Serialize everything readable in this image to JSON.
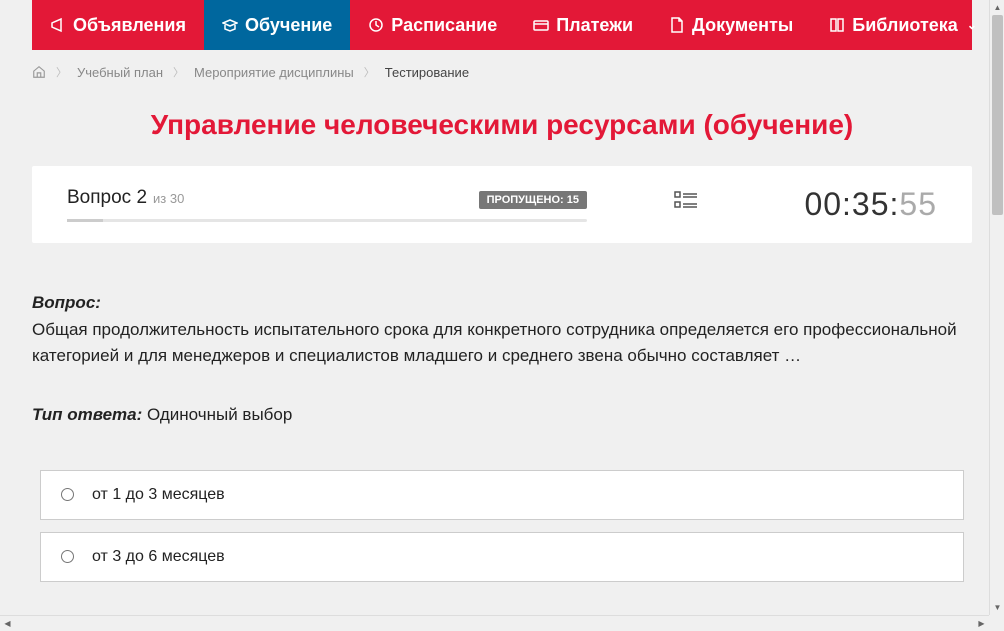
{
  "nav": {
    "items": [
      {
        "label": "Объявления",
        "icon": "megaphone"
      },
      {
        "label": "Обучение",
        "icon": "graduation",
        "active": true
      },
      {
        "label": "Расписание",
        "icon": "clock"
      },
      {
        "label": "Платежи",
        "icon": "card"
      },
      {
        "label": "Документы",
        "icon": "document"
      },
      {
        "label": "Библиотека",
        "icon": "book",
        "dropdown": true
      }
    ]
  },
  "breadcrumb": {
    "items": [
      {
        "label": "Учебный план"
      },
      {
        "label": "Мероприятие дисциплины"
      },
      {
        "label": "Тестирование",
        "current": true
      }
    ]
  },
  "page_title": "Управление человеческими ресурсами (обучение)",
  "progress": {
    "question_label": "Вопрос 2",
    "total_label": "из 30",
    "skipped_label": "ПРОПУЩЕНО: 15"
  },
  "timer": {
    "main": "00:35:",
    "seconds": "55"
  },
  "question": {
    "label": "Вопрос:",
    "text": "Общая продолжительность испытательного срока для конкретного сотрудника определяется его профессиональной категорией и для менеджеров и специалистов младшего и среднего звена обычно составляет …"
  },
  "answer_type": {
    "label": "Тип ответа:",
    "value": "Одиночный выбор"
  },
  "answers": [
    {
      "text": "от 1 до 3 месяцев"
    },
    {
      "text": "от 3 до 6 месяцев"
    }
  ]
}
